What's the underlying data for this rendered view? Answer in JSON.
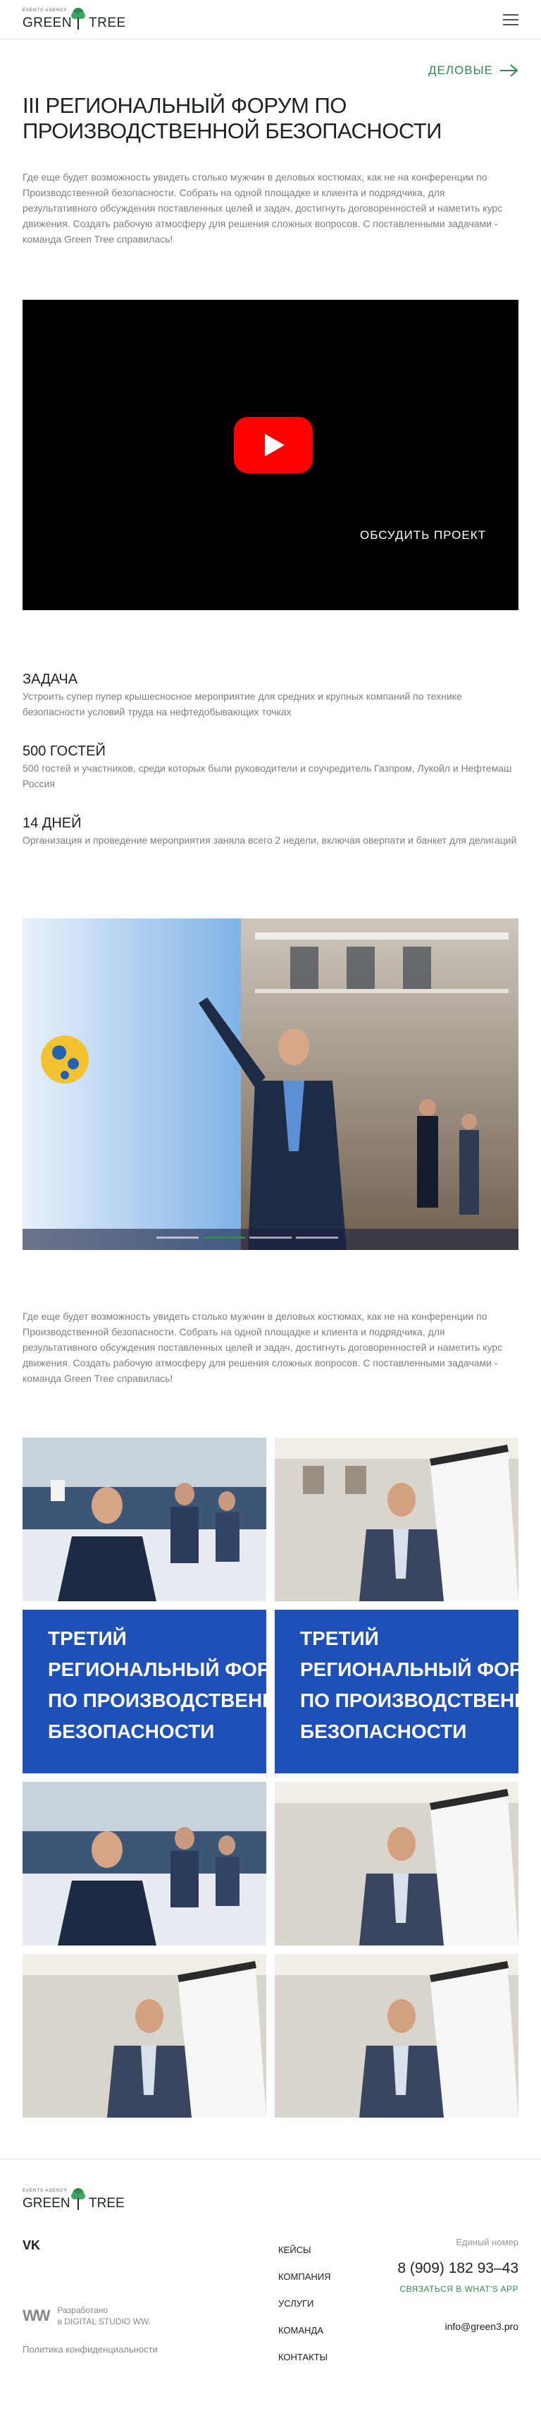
{
  "header": {
    "logo_tagline": "EVENTS AGENCY",
    "logo_word_left": "GREEN",
    "logo_word_right": "TREE",
    "menu_icon": "hamburger-icon"
  },
  "case": {
    "category_label": "ДЕЛОВЫЕ",
    "title": "III РЕГИОНАЛЬНЫЙ ФОРУМ ПО ПРОИЗВОДСТВЕННОЙ БЕЗОПАСНОСТИ",
    "intro": "Где еще будет возможность увидеть столько мужчин в деловых костюмах, как не на конференции по Производственной безопасности. Собрать на одной площадке и клиента и подрядчика, для результативного обсуждения поставленных целей и задач, достигнуть договоренностей и наметить курс движения. Создать рабочую атмосферу для решения сложных вопросов. С поставленными задачами - команда Green Tree справилась!",
    "video_button": "ОБСУДИТЬ ПРОЕКТ",
    "outro": "Где еще будет возможность увидеть столько мужчин в деловых костюмах, как не на конференции по Производственной безопасности. Собрать на одной площадке и клиента и подрядчика, для результативного обсуждения поставленных целей и задач, достигнуть договоренностей и наметить курс движения. Создать рабочую атмосферу для решения сложных вопросов. С поставленными задачами - команда Green Tree справилась!"
  },
  "stats": [
    {
      "title": "ЗАДАЧА",
      "text": "Устроить супер пупер крышесносное мероприятие для средних и крупных компаний по технике безопасности условий труда на нефтедобывающих точках"
    },
    {
      "title": "500 ГОСТЕЙ",
      "text": "500 гостей и участников, среди которых были руководители и соучредитель Газпром, Лукойл и Нефтемаш Россия"
    },
    {
      "title": "14 ДНЕЙ",
      "text": "Организация и проведение мероприятия заняла всего 2 недели, включая оверпати и банкет для делигаций"
    }
  ],
  "slider": {
    "slides": 4,
    "active_index": 1
  },
  "gallery": {
    "banner_line1": "ТРЕТИЙ",
    "banner_line2": "РЕГИОНАЛЬНЫЙ ФОРУМ",
    "banner_line3": "ПО ПРОИЗВОДСТВЕННОЙ",
    "banner_line4": "БЕЗОПАСНОСТИ"
  },
  "footer": {
    "vk_label": "VK",
    "dev_logo": "WW",
    "dev_line1": "Разработано",
    "dev_line2": "в DIGITAL STUDIO WW.",
    "policy": "Политика конфиденциальности",
    "nav": [
      "КЕЙСЫ",
      "КОМПАНИЯ",
      "УСЛУГИ",
      "КОМАНДА",
      "КОНТАКТЫ"
    ],
    "phone_label": "Единый номер",
    "phone": "8 (909) 182 93–43",
    "whatsapp": "СВЯЗАТЬСЯ В WHAT'S APP",
    "email": "info@green3.pro"
  },
  "colors": {
    "accent": "#2e8b4e",
    "text": "#1c2222",
    "muted": "#7a7f7f"
  }
}
